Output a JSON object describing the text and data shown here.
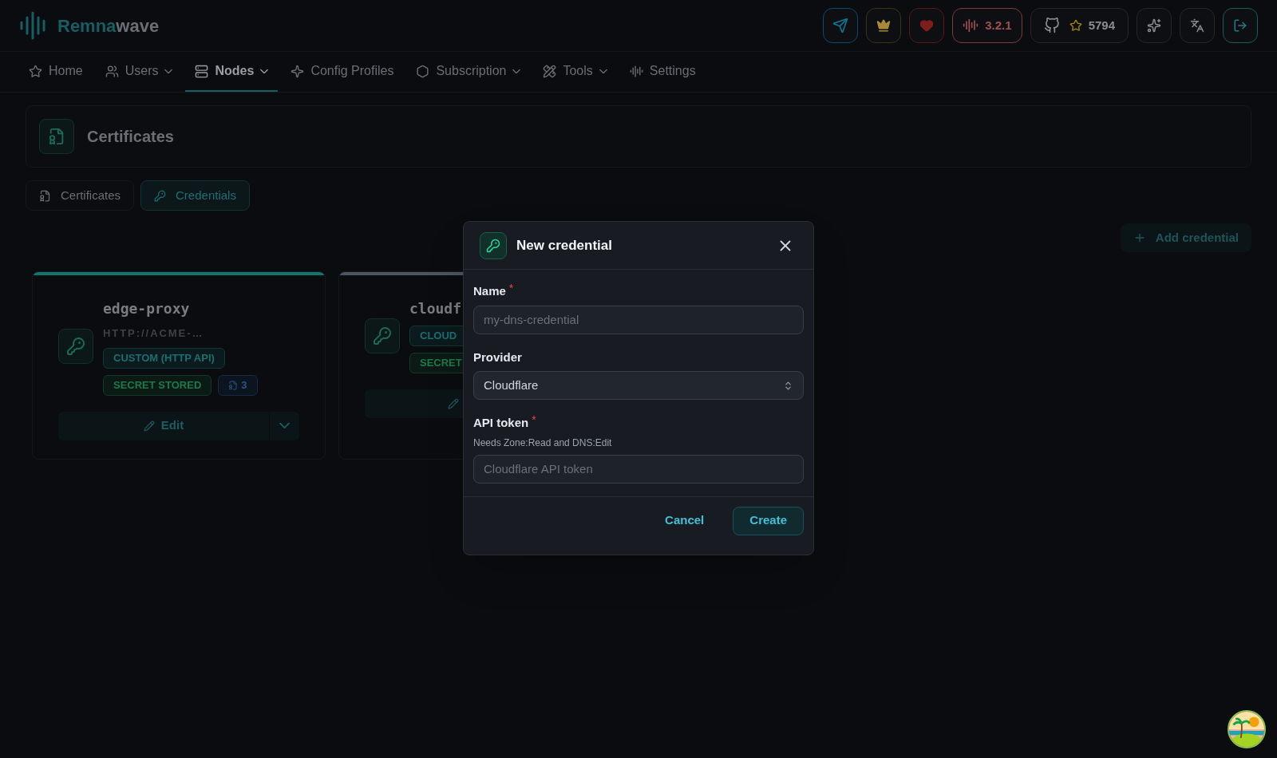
{
  "brand": {
    "part1": "Remna",
    "part2": "wave"
  },
  "header_actions": [
    {
      "kind": "telegram"
    },
    {
      "kind": "crown"
    },
    {
      "kind": "heart"
    },
    {
      "kind": "version",
      "text": "3.2.1"
    },
    {
      "kind": "github",
      "text": "5794"
    },
    {
      "kind": "sparkles"
    },
    {
      "kind": "translate"
    },
    {
      "kind": "logout"
    }
  ],
  "nav": [
    {
      "label": "Home",
      "dropdown": false,
      "selected": false
    },
    {
      "label": "Users",
      "dropdown": true,
      "selected": false
    },
    {
      "label": "Nodes",
      "dropdown": true,
      "selected": true
    },
    {
      "label": "Config Profiles",
      "dropdown": false,
      "selected": false
    },
    {
      "label": "Subscription",
      "dropdown": true,
      "selected": false
    },
    {
      "label": "Tools",
      "dropdown": true,
      "selected": false
    },
    {
      "label": "Settings",
      "dropdown": false,
      "selected": false
    }
  ],
  "page_title": "Certificates",
  "tabs": [
    {
      "label": "Certificates",
      "selected": false
    },
    {
      "label": "Credentials",
      "selected": true
    }
  ],
  "add_button": "Add credential",
  "cards": [
    {
      "name": "edge-proxy",
      "url": "HTTP://ACME-…",
      "provider": "CUSTOM (HTTP API)",
      "secret": "SECRET STORED",
      "count": "3",
      "edit": "Edit",
      "color": "#0f766e"
    },
    {
      "name": "cloudf",
      "provider": "CLOUD",
      "secret": "SECRET",
      "color": "#4b5563"
    }
  ],
  "modal": {
    "title": "New credential",
    "fields": [
      {
        "kind": "input",
        "label": "Name",
        "required_mark": "*",
        "placeholder": "my-dns-credential"
      },
      {
        "kind": "select",
        "label": "Provider",
        "value": "Cloudflare"
      },
      {
        "kind": "input",
        "label": "API token",
        "required_mark": "*",
        "hint": "Needs Zone:Read and DNS:Edit",
        "placeholder": "Cloudflare API token"
      }
    ],
    "buttons": [
      {
        "kind": "secondary",
        "label": "Cancel"
      },
      {
        "kind": "primary",
        "label": "Create"
      }
    ]
  }
}
